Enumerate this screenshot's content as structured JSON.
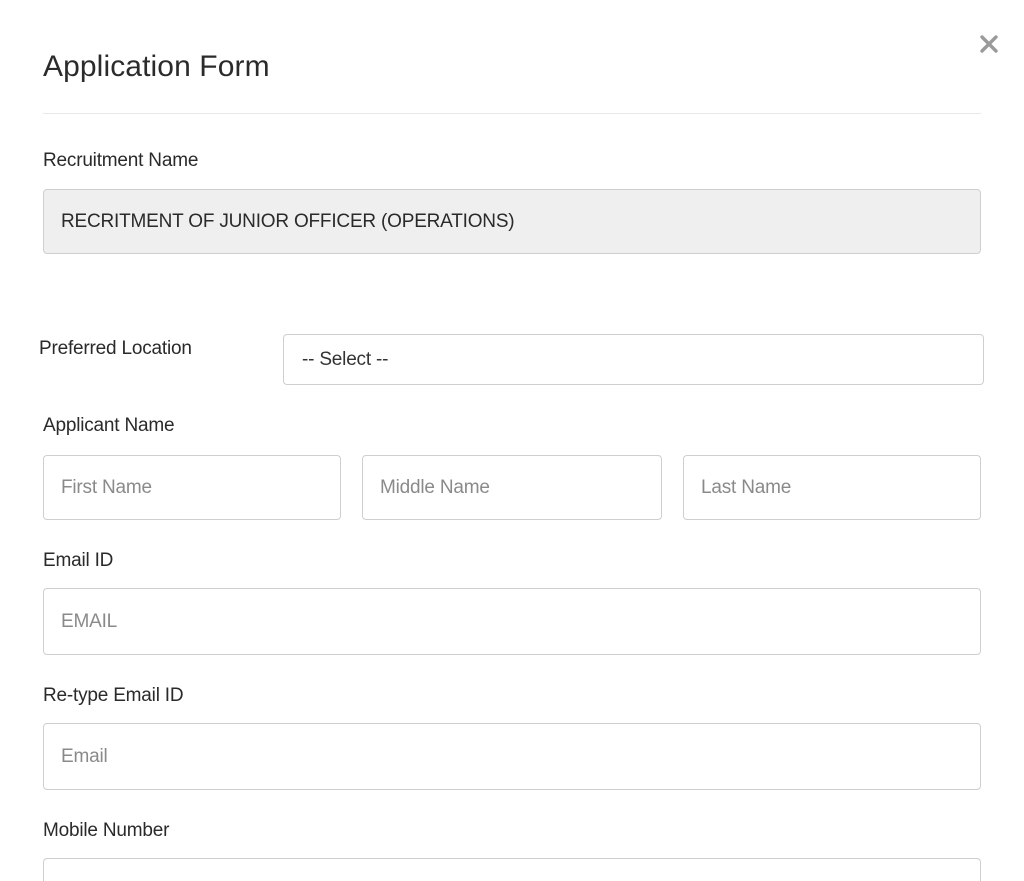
{
  "form": {
    "title": "Application Form",
    "close_icon": "close-icon",
    "recruitment": {
      "label": "Recruitment Name",
      "value": "RECRITMENT OF JUNIOR OFFICER (OPERATIONS)"
    },
    "preferred_location": {
      "label": "Preferred Location",
      "selected": "-- Select --"
    },
    "applicant_name": {
      "label": "Applicant Name",
      "first_placeholder": "First Name",
      "middle_placeholder": "Middle Name",
      "last_placeholder": "Last Name"
    },
    "email": {
      "label": "Email ID",
      "placeholder": "EMAIL"
    },
    "retype_email": {
      "label": "Re-type Email ID",
      "placeholder": "Email"
    },
    "mobile": {
      "label": "Mobile Number",
      "placeholder": ""
    }
  },
  "colors": {
    "background": "#ffffff",
    "readonly_fill": "#efefef",
    "border": "#cfcfcf",
    "placeholder": "#8a8a8a",
    "close_icon": "#9a9a9a"
  }
}
